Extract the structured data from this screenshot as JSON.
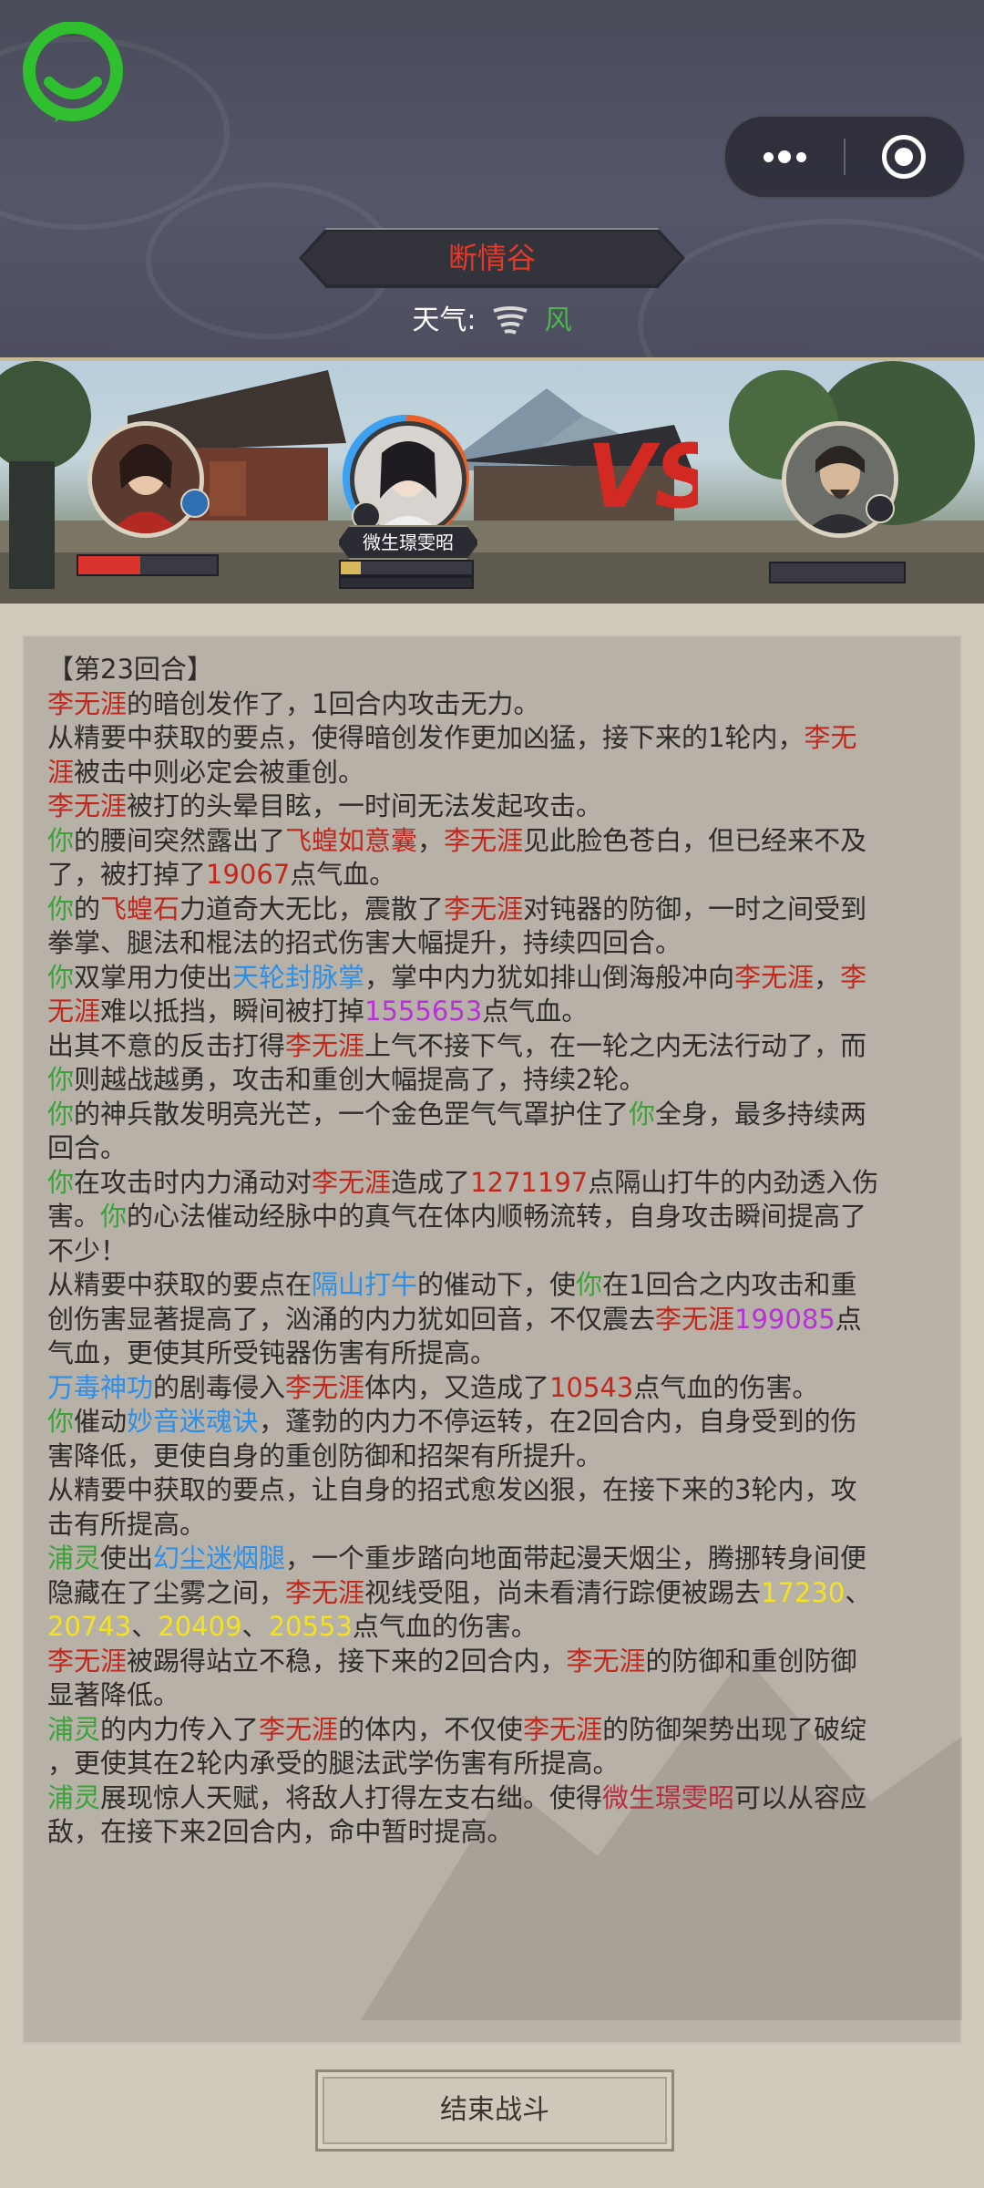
{
  "header": {
    "location": "断情谷",
    "weather_label": "天气:",
    "weather_value": "风",
    "more_icon": "more-dots-icon",
    "close_icon": "mini-program-close-icon",
    "logo_icon": "chat-bubble-logo-icon"
  },
  "battle": {
    "player_hp_ratio": 0.45,
    "ally_hp_ratio": 0.15,
    "ally_name": "微生璟雯昭",
    "enemy_hp_ratio": 0,
    "vs_label": "VS"
  },
  "log": {
    "round_title": "【第23回合】",
    "lines": [
      [
        {
          "t": "李无涯",
          "c": "red"
        },
        {
          "t": "的暗创发作了，1回合内攻击无力。"
        }
      ],
      [
        {
          "t": "从精要中获取的要点，使得暗创发作更加凶猛，接下来的1轮内，"
        },
        {
          "t": "李无",
          "c": "red"
        }
      ],
      [
        {
          "t": "涯",
          "c": "red"
        },
        {
          "t": "被击中则必定会被重创。"
        }
      ],
      [
        {
          "t": "李无涯",
          "c": "red"
        },
        {
          "t": "被打的头晕目眩，一时间无法发起攻击。"
        }
      ],
      [
        {
          "t": "你",
          "c": "green"
        },
        {
          "t": "的腰间突然露出了"
        },
        {
          "t": "飞蝗如意囊",
          "c": "red"
        },
        {
          "t": "，"
        },
        {
          "t": "李无涯",
          "c": "red"
        },
        {
          "t": "见此脸色苍白，但已经来不及"
        }
      ],
      [
        {
          "t": "了，被打掉了"
        },
        {
          "t": "19067",
          "c": "red"
        },
        {
          "t": "点气血。"
        }
      ],
      [
        {
          "t": "你",
          "c": "green"
        },
        {
          "t": "的"
        },
        {
          "t": "飞蝗石",
          "c": "red"
        },
        {
          "t": "力道奇大无比，震散了"
        },
        {
          "t": "李无涯",
          "c": "red"
        },
        {
          "t": "对钝器的防御，一时之间受到"
        }
      ],
      [
        {
          "t": "拳掌、腿法和棍法的招式伤害大幅提升，持续四回合。"
        }
      ],
      [
        {
          "t": "你",
          "c": "green"
        },
        {
          "t": "双掌用力使出"
        },
        {
          "t": "天轮封脉掌",
          "c": "blue"
        },
        {
          "t": "，掌中内力犹如排山倒海般冲向"
        },
        {
          "t": "李无涯",
          "c": "red"
        },
        {
          "t": "，"
        },
        {
          "t": "李",
          "c": "red"
        }
      ],
      [
        {
          "t": "无涯",
          "c": "red"
        },
        {
          "t": "难以抵挡，瞬间被打掉"
        },
        {
          "t": "1555653",
          "c": "purple"
        },
        {
          "t": "点气血。"
        }
      ],
      [
        {
          "t": "出其不意的反击打得"
        },
        {
          "t": "李无涯",
          "c": "red"
        },
        {
          "t": "上气不接下气，在一轮之内无法行动了，而"
        }
      ],
      [
        {
          "t": "你",
          "c": "green"
        },
        {
          "t": "则越战越勇，攻击和重创大幅提高了，持续2轮。"
        }
      ],
      [
        {
          "t": "你",
          "c": "green"
        },
        {
          "t": "的神兵散发明亮光芒，一个金色罡气气罩护住了"
        },
        {
          "t": "你",
          "c": "green"
        },
        {
          "t": "全身，最多持续两"
        }
      ],
      [
        {
          "t": "回合。"
        }
      ],
      [
        {
          "t": "你",
          "c": "green"
        },
        {
          "t": "在攻击时内力涌动对"
        },
        {
          "t": "李无涯",
          "c": "red"
        },
        {
          "t": "造成了"
        },
        {
          "t": "1271197",
          "c": "red"
        },
        {
          "t": "点隔山打牛的内劲透入伤"
        }
      ],
      [
        {
          "t": "害。"
        },
        {
          "t": "你",
          "c": "green"
        },
        {
          "t": "的心法催动经脉中的真气在体内顺畅流转，自身攻击瞬间提高了"
        }
      ],
      [
        {
          "t": "不少！"
        }
      ],
      [
        {
          "t": "从精要中获取的要点在"
        },
        {
          "t": "隔山打牛",
          "c": "blue"
        },
        {
          "t": "的催动下，使"
        },
        {
          "t": "你",
          "c": "green"
        },
        {
          "t": "在1回合之内攻击和重"
        }
      ],
      [
        {
          "t": "创伤害显著提高了，汹涌的内力犹如回音，不仅震去"
        },
        {
          "t": "李无涯",
          "c": "red"
        },
        {
          "t": "199085",
          "c": "purple"
        },
        {
          "t": "点"
        }
      ],
      [
        {
          "t": "气血，更使其所受钝器伤害有所提高。"
        }
      ],
      [
        {
          "t": "万毒神功",
          "c": "blue"
        },
        {
          "t": "的剧毒侵入"
        },
        {
          "t": "李无涯",
          "c": "red"
        },
        {
          "t": "体内，又造成了"
        },
        {
          "t": "10543",
          "c": "red"
        },
        {
          "t": "点气血的伤害。"
        }
      ],
      [
        {
          "t": "你",
          "c": "green"
        },
        {
          "t": "催动"
        },
        {
          "t": "妙音迷魂诀",
          "c": "blue"
        },
        {
          "t": "，蓬勃的内力不停运转，在2回合内，自身受到的伤"
        }
      ],
      [
        {
          "t": "害降低，更使自身的重创防御和招架有所提升。"
        }
      ],
      [
        {
          "t": "从精要中获取的要点，让自身的招式愈发凶狠，在接下来的3轮内，攻"
        }
      ],
      [
        {
          "t": "击有所提高。"
        }
      ],
      [
        {
          "t": "浦灵",
          "c": "green"
        },
        {
          "t": "使出"
        },
        {
          "t": "幻尘迷烟腿",
          "c": "blue"
        },
        {
          "t": "，一个重步踏向地面带起漫天烟尘，腾挪转身间便"
        }
      ],
      [
        {
          "t": "隐藏在了尘雾之间，"
        },
        {
          "t": "李无涯",
          "c": "red"
        },
        {
          "t": "视线受阻，尚未看清行踪便被踢去"
        },
        {
          "t": "17230",
          "c": "yellow"
        },
        {
          "t": "、"
        }
      ],
      [
        {
          "t": "20743",
          "c": "yellow"
        },
        {
          "t": "、"
        },
        {
          "t": "20409",
          "c": "yellow"
        },
        {
          "t": "、"
        },
        {
          "t": "20553",
          "c": "yellow"
        },
        {
          "t": "点气血的伤害。"
        }
      ],
      [
        {
          "t": "李无涯",
          "c": "red"
        },
        {
          "t": "被踢得站立不稳，接下来的2回合内，"
        },
        {
          "t": "李无涯",
          "c": "red"
        },
        {
          "t": "的防御和重创防御"
        }
      ],
      [
        {
          "t": "显著降低。"
        }
      ],
      [
        {
          "t": "浦灵",
          "c": "green"
        },
        {
          "t": "的内力传入了"
        },
        {
          "t": "李无涯",
          "c": "red"
        },
        {
          "t": "的体内，不仅使"
        },
        {
          "t": "李无涯",
          "c": "red"
        },
        {
          "t": "的防御架势出现了破绽"
        }
      ],
      [
        {
          "t": "，更使其在2轮内承受的腿法武学伤害有所提高。"
        }
      ],
      [
        {
          "t": "浦灵",
          "c": "green"
        },
        {
          "t": "展现惊人天赋，将敌人打得左支右绌。使得"
        },
        {
          "t": "微生璟雯昭",
          "c": "maroon"
        },
        {
          "t": "可以从容应"
        }
      ],
      [
        {
          "t": "敌，在接下来2回合内，命中暂时提高。"
        }
      ]
    ]
  },
  "footer": {
    "end_battle_label": "结束战斗"
  },
  "colors": {
    "red": "#c0281d",
    "green": "#39a33a",
    "blue": "#2e8fe6",
    "purple": "#b732d6",
    "yellow": "#f3e21f",
    "maroon": "#b52e3f"
  }
}
